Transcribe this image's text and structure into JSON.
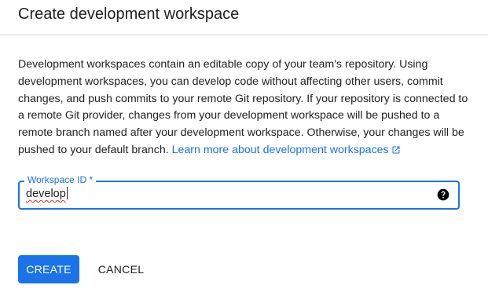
{
  "dialog": {
    "title": "Create development workspace",
    "description": "Development workspaces contain an editable copy of your team's repository. Using development workspaces, you can develop code without affecting other users, commit changes, and push commits to your remote Git repository. If your repository is connected to a remote Git provider, changes from your development workspace will be pushed to a remote branch named after your development workspace. Otherwise, your changes will be pushed to your default branch.",
    "learn_more_label": "Learn more about development workspaces",
    "learn_more_icon": "open-in-new-icon"
  },
  "workspace_field": {
    "label": "Workspace ID *",
    "value": "develop",
    "help_icon": "help-circle-icon"
  },
  "actions": {
    "create_label": "CREATE",
    "cancel_label": "CANCEL"
  },
  "colors": {
    "accent": "#1a73e8",
    "text": "#202124",
    "divider": "#dadce0"
  }
}
